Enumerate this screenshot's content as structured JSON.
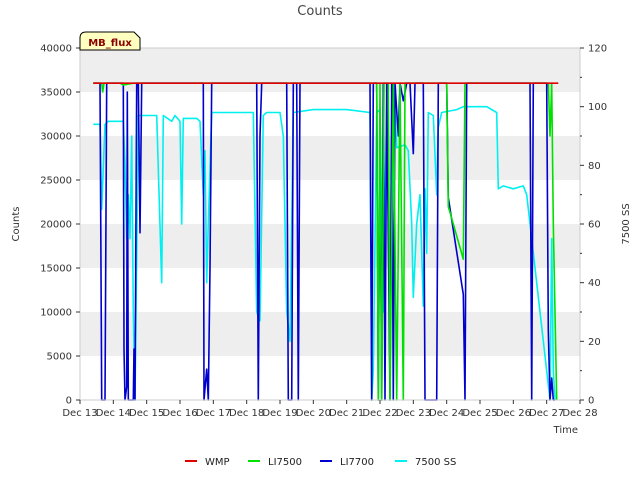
{
  "chart_data": {
    "type": "line",
    "title": "Counts",
    "xlabel": "Time",
    "ylabel": "Counts",
    "y2label": "7500 SS",
    "badge": "MB_flux",
    "x_range": [
      13,
      28
    ],
    "x_ticks": [
      {
        "v": 13,
        "label": "Dec 13"
      },
      {
        "v": 14,
        "label": "Dec 14"
      },
      {
        "v": 15,
        "label": "Dec 15"
      },
      {
        "v": 16,
        "label": "Dec 16"
      },
      {
        "v": 17,
        "label": "Dec 17"
      },
      {
        "v": 18,
        "label": "Dec 18"
      },
      {
        "v": 19,
        "label": "Dec 19"
      },
      {
        "v": 20,
        "label": "Dec 20"
      },
      {
        "v": 21,
        "label": "Dec 21"
      },
      {
        "v": 22,
        "label": "Dec 22"
      },
      {
        "v": 23,
        "label": "Dec 23"
      },
      {
        "v": 24,
        "label": "Dec 24"
      },
      {
        "v": 25,
        "label": "Dec 25"
      },
      {
        "v": 26,
        "label": "Dec 26"
      },
      {
        "v": 27,
        "label": "Dec 27"
      },
      {
        "v": 28,
        "label": "Dec 28"
      }
    ],
    "ylim": [
      0,
      40000
    ],
    "y_ticks": [
      0,
      5000,
      10000,
      15000,
      20000,
      25000,
      30000,
      35000,
      40000
    ],
    "y2lim": [
      0,
      120
    ],
    "y2_ticks": [
      0,
      20,
      40,
      60,
      80,
      100,
      120
    ],
    "grid": "horizontal-bands",
    "legend_position": "bottom",
    "series": [
      {
        "name": "WMP",
        "color": "#e00000",
        "axis": "left",
        "points": [
          [
            13.4,
            36000
          ],
          [
            22.0,
            36000
          ],
          [
            22.05,
            36000
          ],
          [
            22.9,
            36000
          ],
          [
            24.0,
            36000
          ],
          [
            27.35,
            36000
          ]
        ]
      },
      {
        "name": "LI7500",
        "color": "#00e000",
        "axis": "left",
        "points": [
          [
            13.4,
            36000
          ],
          [
            13.65,
            36000
          ],
          [
            13.68,
            35000
          ],
          [
            13.72,
            36000
          ],
          [
            14.2,
            36000
          ],
          [
            14.3,
            35800
          ],
          [
            14.6,
            36000
          ],
          [
            21.9,
            36000
          ],
          [
            21.95,
            0
          ],
          [
            22.0,
            36000
          ],
          [
            22.05,
            0
          ],
          [
            22.12,
            36000
          ],
          [
            22.25,
            36000
          ],
          [
            22.3,
            0
          ],
          [
            22.4,
            36000
          ],
          [
            22.5,
            0
          ],
          [
            22.6,
            36000
          ],
          [
            22.7,
            0
          ],
          [
            22.75,
            36000
          ],
          [
            24.0,
            36000
          ],
          [
            24.05,
            22000
          ],
          [
            24.5,
            16000
          ],
          [
            24.55,
            36000
          ],
          [
            27.05,
            36000
          ],
          [
            27.1,
            30000
          ],
          [
            27.15,
            36000
          ],
          [
            27.2,
            20000
          ],
          [
            27.3,
            0
          ]
        ]
      },
      {
        "name": "LI7700",
        "color": "#0000cc",
        "axis": "left",
        "points": [
          [
            13.4,
            36000
          ],
          [
            13.6,
            36000
          ],
          [
            13.65,
            0
          ],
          [
            13.75,
            0
          ],
          [
            13.8,
            36000
          ],
          [
            14.3,
            36000
          ],
          [
            14.32,
            5800
          ],
          [
            14.35,
            0
          ],
          [
            14.4,
            1500
          ],
          [
            14.42,
            35000
          ],
          [
            14.45,
            0
          ],
          [
            14.6,
            0
          ],
          [
            14.62,
            5800
          ],
          [
            14.65,
            0
          ],
          [
            14.7,
            36000
          ],
          [
            14.75,
            36000
          ],
          [
            14.8,
            19000
          ],
          [
            14.85,
            36000
          ],
          [
            16.7,
            36000
          ],
          [
            16.72,
            0
          ],
          [
            16.8,
            3500
          ],
          [
            16.85,
            0
          ],
          [
            16.9,
            15000
          ],
          [
            16.95,
            36000
          ],
          [
            18.3,
            36000
          ],
          [
            18.35,
            0
          ],
          [
            18.4,
            30000
          ],
          [
            18.45,
            36000
          ],
          [
            19.2,
            36000
          ],
          [
            19.25,
            0
          ],
          [
            19.35,
            0
          ],
          [
            19.4,
            36000
          ],
          [
            19.5,
            36000
          ],
          [
            19.55,
            0
          ],
          [
            19.6,
            36000
          ],
          [
            21.7,
            36000
          ],
          [
            21.75,
            0
          ],
          [
            21.8,
            36000
          ],
          [
            21.9,
            36000
          ],
          [
            21.95,
            0
          ],
          [
            22.0,
            30000
          ],
          [
            22.05,
            0
          ],
          [
            22.1,
            36000
          ],
          [
            22.15,
            0
          ],
          [
            22.2,
            36000
          ],
          [
            22.3,
            0
          ],
          [
            22.35,
            36000
          ],
          [
            22.4,
            0
          ],
          [
            22.45,
            36000
          ],
          [
            22.55,
            30000
          ],
          [
            22.6,
            36000
          ],
          [
            22.7,
            34000
          ],
          [
            22.8,
            36000
          ],
          [
            22.9,
            36000
          ],
          [
            23.0,
            28000
          ],
          [
            23.05,
            36000
          ],
          [
            23.3,
            36000
          ],
          [
            23.35,
            0
          ],
          [
            23.7,
            0
          ],
          [
            23.75,
            36000
          ],
          [
            24.0,
            36000
          ],
          [
            24.05,
            23000
          ],
          [
            24.5,
            12000
          ],
          [
            24.55,
            0
          ],
          [
            24.6,
            36000
          ],
          [
            26.5,
            36000
          ],
          [
            26.55,
            0
          ],
          [
            26.6,
            36000
          ],
          [
            27.0,
            36000
          ],
          [
            27.05,
            8000
          ],
          [
            27.1,
            0
          ],
          [
            27.15,
            2500
          ],
          [
            27.2,
            0
          ],
          [
            27.25,
            0
          ]
        ]
      },
      {
        "name": "7500 SS",
        "color": "#00f0f0",
        "axis": "right",
        "points": [
          [
            13.4,
            94
          ],
          [
            13.6,
            94
          ],
          [
            13.65,
            65
          ],
          [
            13.75,
            94
          ],
          [
            13.85,
            95
          ],
          [
            14.3,
            95
          ],
          [
            14.35,
            80
          ],
          [
            14.4,
            55
          ],
          [
            14.45,
            70
          ],
          [
            14.5,
            55
          ],
          [
            14.55,
            90
          ],
          [
            14.6,
            30
          ],
          [
            14.65,
            0
          ],
          [
            14.75,
            97
          ],
          [
            15.2,
            97
          ],
          [
            15.3,
            97
          ],
          [
            15.45,
            40
          ],
          [
            15.5,
            97
          ],
          [
            15.75,
            95
          ],
          [
            15.85,
            97
          ],
          [
            16.0,
            95
          ],
          [
            16.05,
            60
          ],
          [
            16.1,
            96
          ],
          [
            16.5,
            96
          ],
          [
            16.6,
            95
          ],
          [
            16.7,
            70
          ],
          [
            16.75,
            85
          ],
          [
            16.8,
            40
          ],
          [
            16.85,
            60
          ],
          [
            16.95,
            98
          ],
          [
            17.5,
            98
          ],
          [
            18.0,
            98
          ],
          [
            18.2,
            98
          ],
          [
            18.3,
            30
          ],
          [
            18.4,
            27
          ],
          [
            18.5,
            97
          ],
          [
            18.6,
            98
          ],
          [
            19.0,
            98
          ],
          [
            19.1,
            90
          ],
          [
            19.2,
            30
          ],
          [
            19.3,
            20
          ],
          [
            19.4,
            98
          ],
          [
            20.0,
            99
          ],
          [
            21.0,
            99
          ],
          [
            21.7,
            98
          ],
          [
            21.75,
            0
          ],
          [
            21.8,
            10
          ],
          [
            21.9,
            98
          ],
          [
            22.0,
            99
          ],
          [
            22.1,
            30
          ],
          [
            22.2,
            99
          ],
          [
            22.3,
            40
          ],
          [
            22.45,
            99
          ],
          [
            22.5,
            86
          ],
          [
            22.75,
            87
          ],
          [
            22.85,
            85
          ],
          [
            22.95,
            60
          ],
          [
            23.0,
            35
          ],
          [
            23.1,
            60
          ],
          [
            23.2,
            70
          ],
          [
            23.3,
            32
          ],
          [
            23.35,
            72
          ],
          [
            23.4,
            50
          ],
          [
            23.45,
            98
          ],
          [
            23.6,
            97
          ],
          [
            23.7,
            70
          ],
          [
            23.75,
            93
          ],
          [
            23.85,
            98
          ],
          [
            24.3,
            99
          ],
          [
            24.5,
            100
          ],
          [
            24.6,
            100
          ],
          [
            25.2,
            100
          ],
          [
            25.5,
            98
          ],
          [
            25.55,
            72
          ],
          [
            25.7,
            73
          ],
          [
            26.0,
            72
          ],
          [
            26.3,
            73
          ],
          [
            26.4,
            70
          ],
          [
            27.1,
            0
          ],
          [
            27.15,
            55
          ],
          [
            27.2,
            10
          ],
          [
            27.25,
            0
          ]
        ]
      }
    ]
  }
}
